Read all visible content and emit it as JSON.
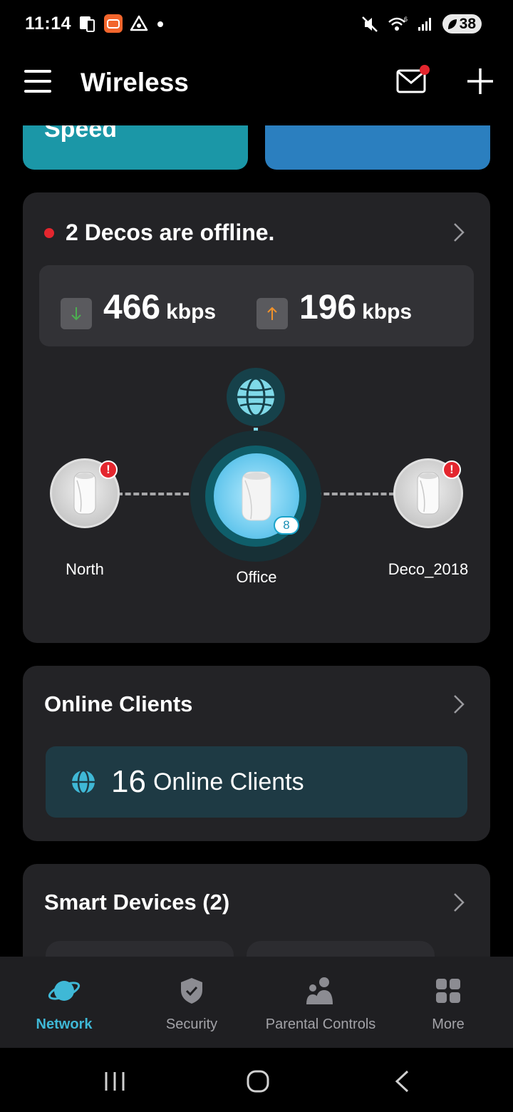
{
  "status_bar": {
    "time": "11:14",
    "battery": "38"
  },
  "header": {
    "title": "Wireless"
  },
  "top_cards": {
    "speed_label": "Speed"
  },
  "network": {
    "offline_message": "2 Decos are offline.",
    "download": {
      "value": "466",
      "unit": "kbps"
    },
    "upload": {
      "value": "196",
      "unit": "kbps"
    },
    "main_node": {
      "name": "Office",
      "client_count": "8"
    },
    "satellites": [
      {
        "name": "North",
        "alert": "!"
      },
      {
        "name": "Deco_2018",
        "alert": "!"
      }
    ]
  },
  "online_clients": {
    "title": "Online Clients",
    "count": "16",
    "label": "Online Clients"
  },
  "smart_devices": {
    "title": "Smart Devices (2)"
  },
  "bottom_nav": [
    {
      "label": "Network",
      "icon": "planet-icon",
      "active": true
    },
    {
      "label": "Security",
      "icon": "shield-icon",
      "active": false
    },
    {
      "label": "Parental Controls",
      "icon": "family-icon",
      "active": false
    },
    {
      "label": "More",
      "icon": "grid-icon",
      "active": false
    }
  ],
  "colors": {
    "accent": "#3fb8d6",
    "alert": "#e4262e",
    "card_bg": "#232326",
    "download_arrow": "#4caf50",
    "upload_arrow": "#f0922b"
  }
}
